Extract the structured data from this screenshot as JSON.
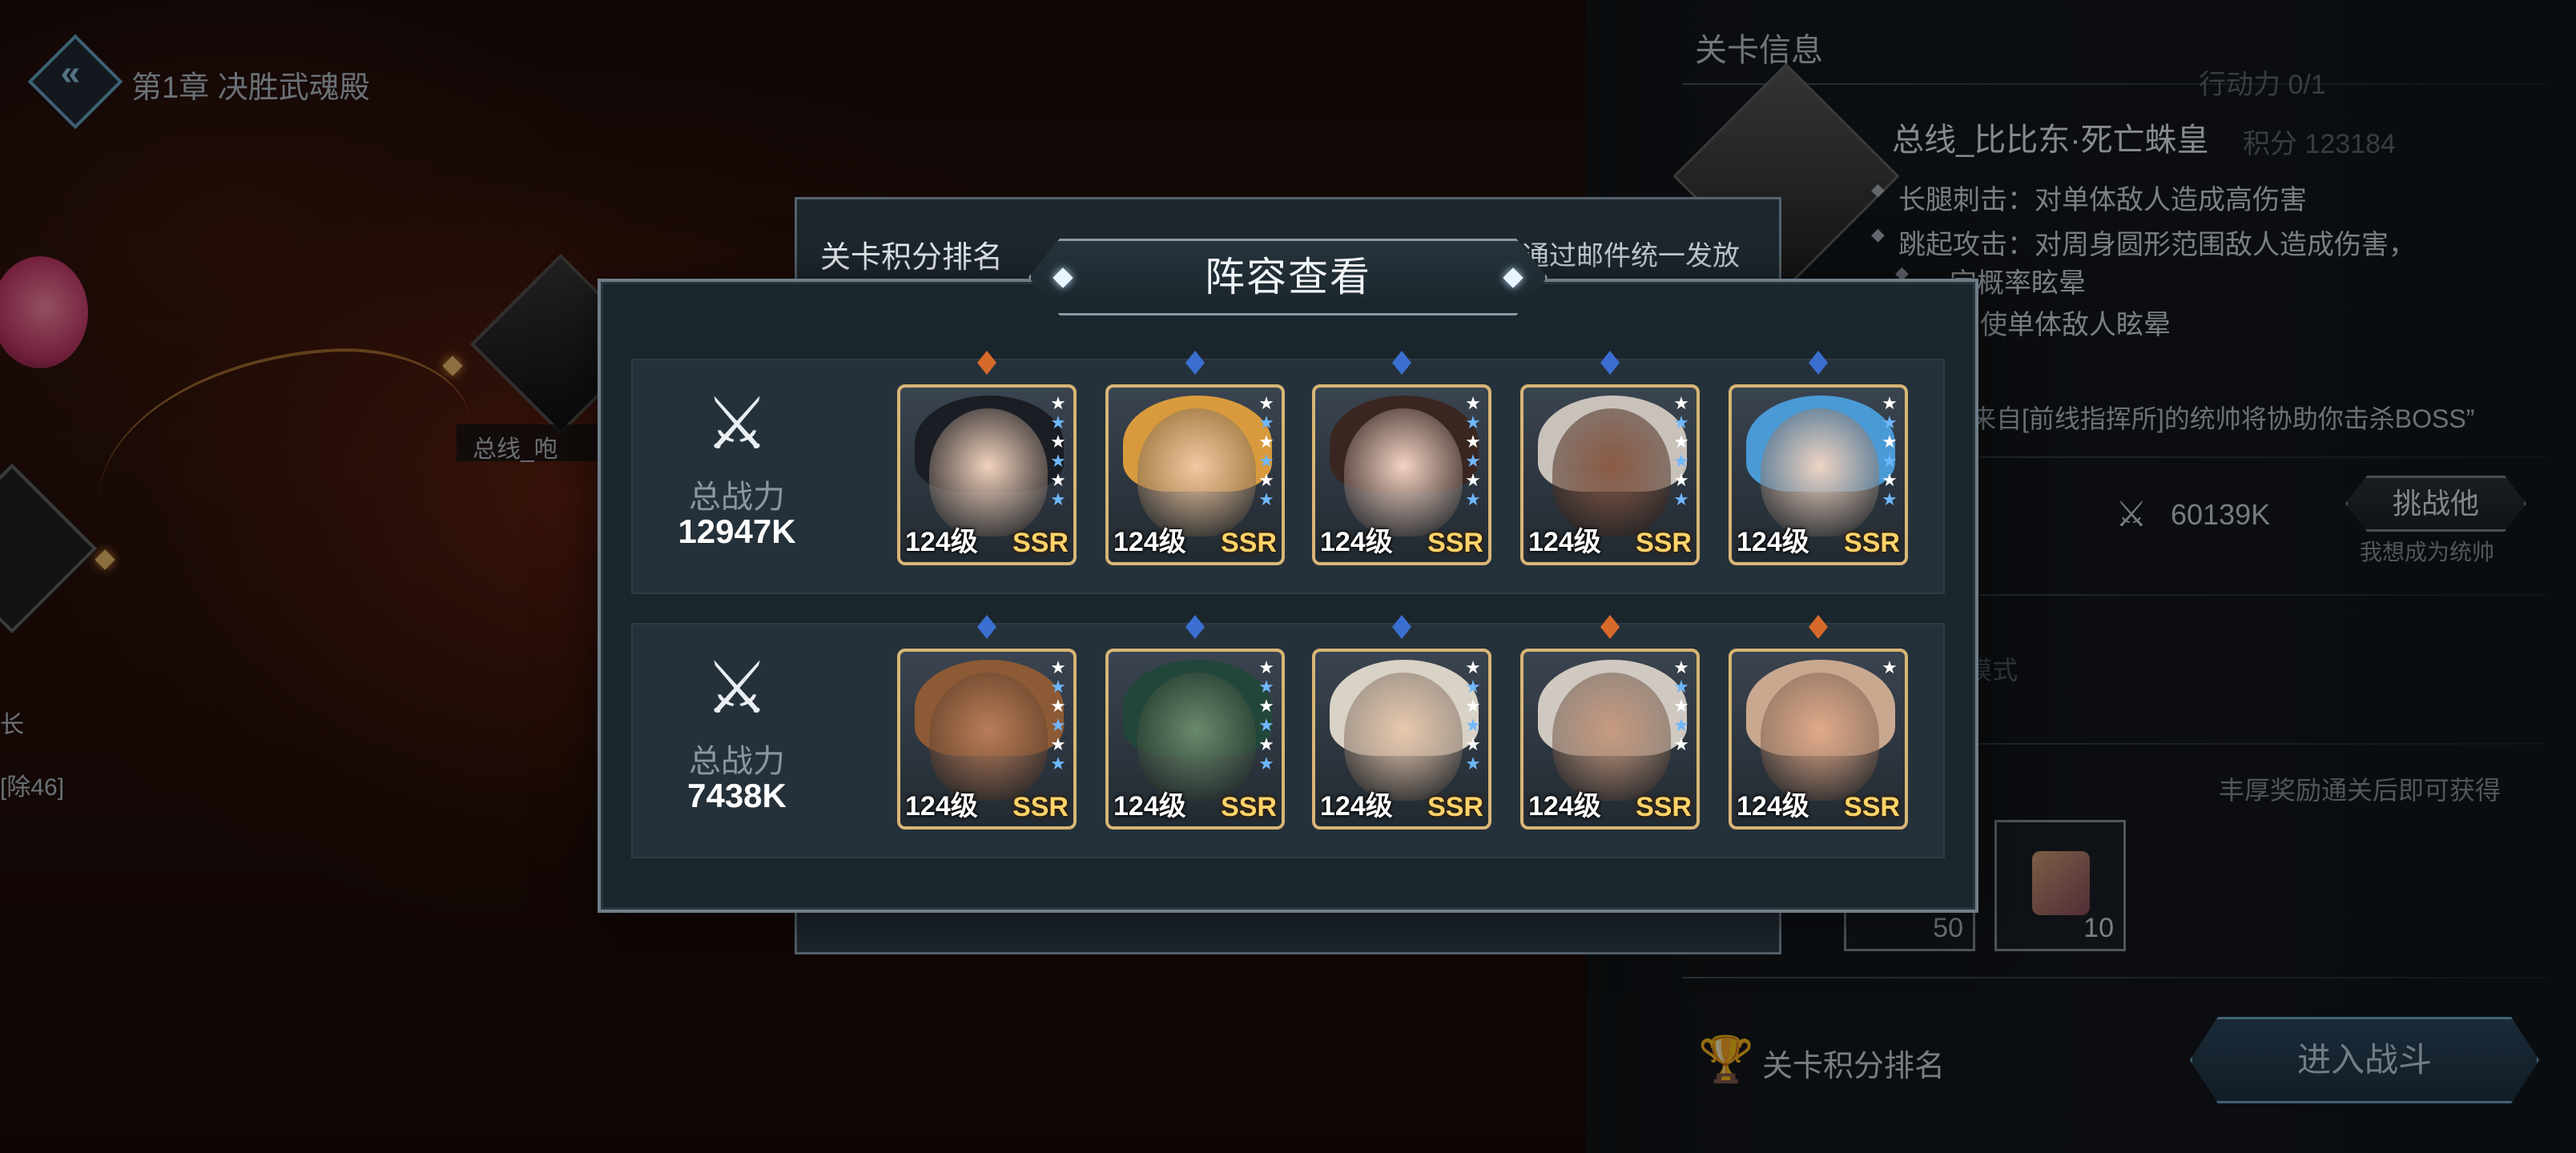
{
  "chapter": {
    "title": "第1章 决胜武魂殿"
  },
  "map": {
    "node_label": "总线_咆",
    "side_text_1": "长",
    "side_text_2": "[除46]"
  },
  "stage_panel": {
    "header": "关卡信息",
    "stamina_label": "行动力",
    "stamina_value": "0/1",
    "score_label": "积分",
    "score_value": "123184",
    "boss_name": "总线_比比东·死亡蛛皇",
    "skills": [
      "长腿刺击：对单体敌人造成高伤害",
      "跳起攻击：对周身圆形范围敌人造成伤害，",
      "一定概率眩晕",
      "缠绕：使单体敌人眩晕"
    ],
    "hint": "来自[前线指挥所]的统帅将协助你击杀BOSS”",
    "power_value": "60139K",
    "challenge_label": "挑战他",
    "challenge_sub": "我想成为统帅",
    "mode_label": "模式",
    "reward_note": "丰厚奖励通关后即可获得",
    "rewards": [
      {
        "qty": "50"
      },
      {
        "qty": "10"
      }
    ],
    "rank_link": "关卡积分排名",
    "enter_label": "进入战斗"
  },
  "rank_dialog": {
    "title": "关卡积分排名",
    "note": "通过邮件统一发放"
  },
  "lineup_modal": {
    "title": "阵容查看",
    "power_label": "总战力",
    "teams": [
      {
        "power": "12947K",
        "heroes": [
          {
            "level": "124级",
            "rarity": "SSR",
            "stars": 6,
            "gem": "#d76a2a",
            "hair": "#1a1d24",
            "skin": "#f1d2bd"
          },
          {
            "level": "124级",
            "rarity": "SSR",
            "stars": 6,
            "gem": "#3a6fd1",
            "hair": "#d89a3c",
            "skin": "#f0c9a2"
          },
          {
            "level": "124级",
            "rarity": "SSR",
            "stars": 6,
            "gem": "#3a6fd1",
            "hair": "#3a2620",
            "skin": "#f3d3c4"
          },
          {
            "level": "124级",
            "rarity": "SSR",
            "stars": 6,
            "gem": "#3a6fd1",
            "hair": "#c9c2bb",
            "skin": "#8a5a45"
          },
          {
            "level": "124级",
            "rarity": "SSR",
            "stars": 6,
            "gem": "#3a6fd1",
            "hair": "#4a9ad6",
            "skin": "#eed4c4"
          }
        ]
      },
      {
        "power": "7438K",
        "heroes": [
          {
            "level": "124级",
            "rarity": "SSR",
            "stars": 6,
            "gem": "#3a6fd1",
            "hair": "#8c5a34",
            "skin": "#b97d5a"
          },
          {
            "level": "124级",
            "rarity": "SSR",
            "stars": 6,
            "gem": "#3a6fd1",
            "hair": "#23463a",
            "skin": "#6b8a6c"
          },
          {
            "level": "124级",
            "rarity": "SSR",
            "stars": 6,
            "gem": "#3a6fd1",
            "hair": "#d9d2c6",
            "skin": "#e8c8ae"
          },
          {
            "level": "124级",
            "rarity": "SSR",
            "stars": 5,
            "gem": "#d76a2a",
            "hair": "#cfc9c1",
            "skin": "#c79a80"
          },
          {
            "level": "124级",
            "rarity": "SSR",
            "stars": 1,
            "gem": "#d76a2a",
            "hair": "#c9a890",
            "skin": "#e0a98a"
          }
        ]
      }
    ]
  },
  "colors": {
    "star_blue": "#6fb7ff",
    "star_white": "#ffffff",
    "card_border": "#d8b576",
    "rarity": "#ffd36a"
  },
  "icons": [
    "back-chevron-icon",
    "crossed-swords-icon",
    "trophy-icon",
    "star-icon",
    "scroll-icon"
  ]
}
